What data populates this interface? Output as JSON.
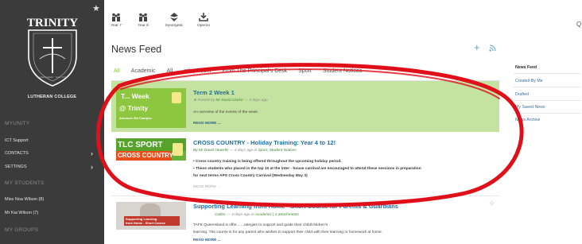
{
  "sidebar": {
    "school_name": "TRINITY",
    "motto": "In altis fundatur · Jesu Christi",
    "college_label": "LUTHERAN COLLEGE",
    "sections": [
      {
        "heading": "MYUNITY",
        "items": [
          {
            "label": "ICT Support",
            "chevron": false
          },
          {
            "label": "CONTACTS",
            "chevron": true
          },
          {
            "label": "SETTINGS",
            "chevron": true
          }
        ]
      },
      {
        "heading": "MY STUDENTS",
        "items": [
          {
            "label": "Miss Noa Wilson (8)",
            "chevron": false
          },
          {
            "label": "Mr Kai Wilson (7)",
            "chevron": false
          }
        ]
      },
      {
        "heading": "MY GROUPS",
        "items": []
      }
    ]
  },
  "topbar": {
    "icons": [
      {
        "label": "Year 7",
        "icon": "group-icon"
      },
      {
        "label": "Year 8",
        "icon": "group-icon"
      },
      {
        "label": "Synergetic",
        "icon": "synergetic-icon"
      },
      {
        "label": "Operoo",
        "icon": "download-icon"
      }
    ],
    "search_label": "Q"
  },
  "page_title": "News Feed",
  "tabs": [
    {
      "label": "All",
      "active": true
    },
    {
      "label": "Academic",
      "active": false
    },
    {
      "label": "All",
      "active": false
    },
    {
      "label": "rship Team",
      "active": false
    },
    {
      "label": "From The Principal's Desk",
      "active": false
    },
    {
      "label": "Sport",
      "active": false
    },
    {
      "label": "Student Notices",
      "active": false
    }
  ],
  "posts": [
    {
      "title": "Term 2 Week 1",
      "meta_prefix": "Posted by",
      "author": "Mr David Clarke",
      "meta_suffix": "— 3 days ago",
      "lines": [
        "An overview of the events of the week."
      ],
      "read_more": "READ MORE ...",
      "thumb": {
        "line1": "T... Week",
        "line2": "@ Trinity",
        "line3": "Ashmore Rd Campus"
      }
    },
    {
      "title": "CROSS COUNTRY - Holiday Training: Year 4 to 12!",
      "author": "By Mr David Howells",
      "meta_suffix": "— 4 days ago in",
      "categories": "Sport, Student Notices",
      "lines": [
        "• Cross country training is being offered throughout the upcoming holiday period.",
        "• These students who placed in the top 10 at the inter - house carnival are encouraged to attend these sessions in preparation",
        "for next terms APS Cross Country Carnival (Wednesday May 3)"
      ],
      "read_more": "READ MORE ...",
      "thumb": {
        "line1": "TLC SPORT",
        "line2": "CROSS COUNTRY"
      }
    },
    {
      "title": "Supporting Learning from Home - Short Course for Parents & Guardians",
      "author": "Cullen",
      "meta_suffix": "— 3 days ago in",
      "categories": "Academic | 1 attachments",
      "lines": [
        "TAFE Queensland is offer... ...rategies to support and guide their child/children's",
        "learning. The course is for any parent who wishes to support their child with their learning or homework at home."
      ],
      "read_more": "READ MORE ...",
      "thumb": {
        "line1": "Supporting Learning",
        "line2": "from Home - Short Course"
      }
    }
  ],
  "right_nav": [
    {
      "label": "News Feed",
      "active": true
    },
    {
      "label": "Created By Me",
      "active": false
    },
    {
      "label": "Drafted",
      "active": false
    },
    {
      "label": "My Saved News",
      "active": false
    },
    {
      "label": "News Archive",
      "active": false
    }
  ],
  "colors": {
    "sidebar": "#3b3b3b",
    "accent_green": "#8dc63f",
    "link_blue": "#1b6fa8",
    "annotation_red": "#e0101a",
    "highlight_row": "#c5e3a0"
  }
}
